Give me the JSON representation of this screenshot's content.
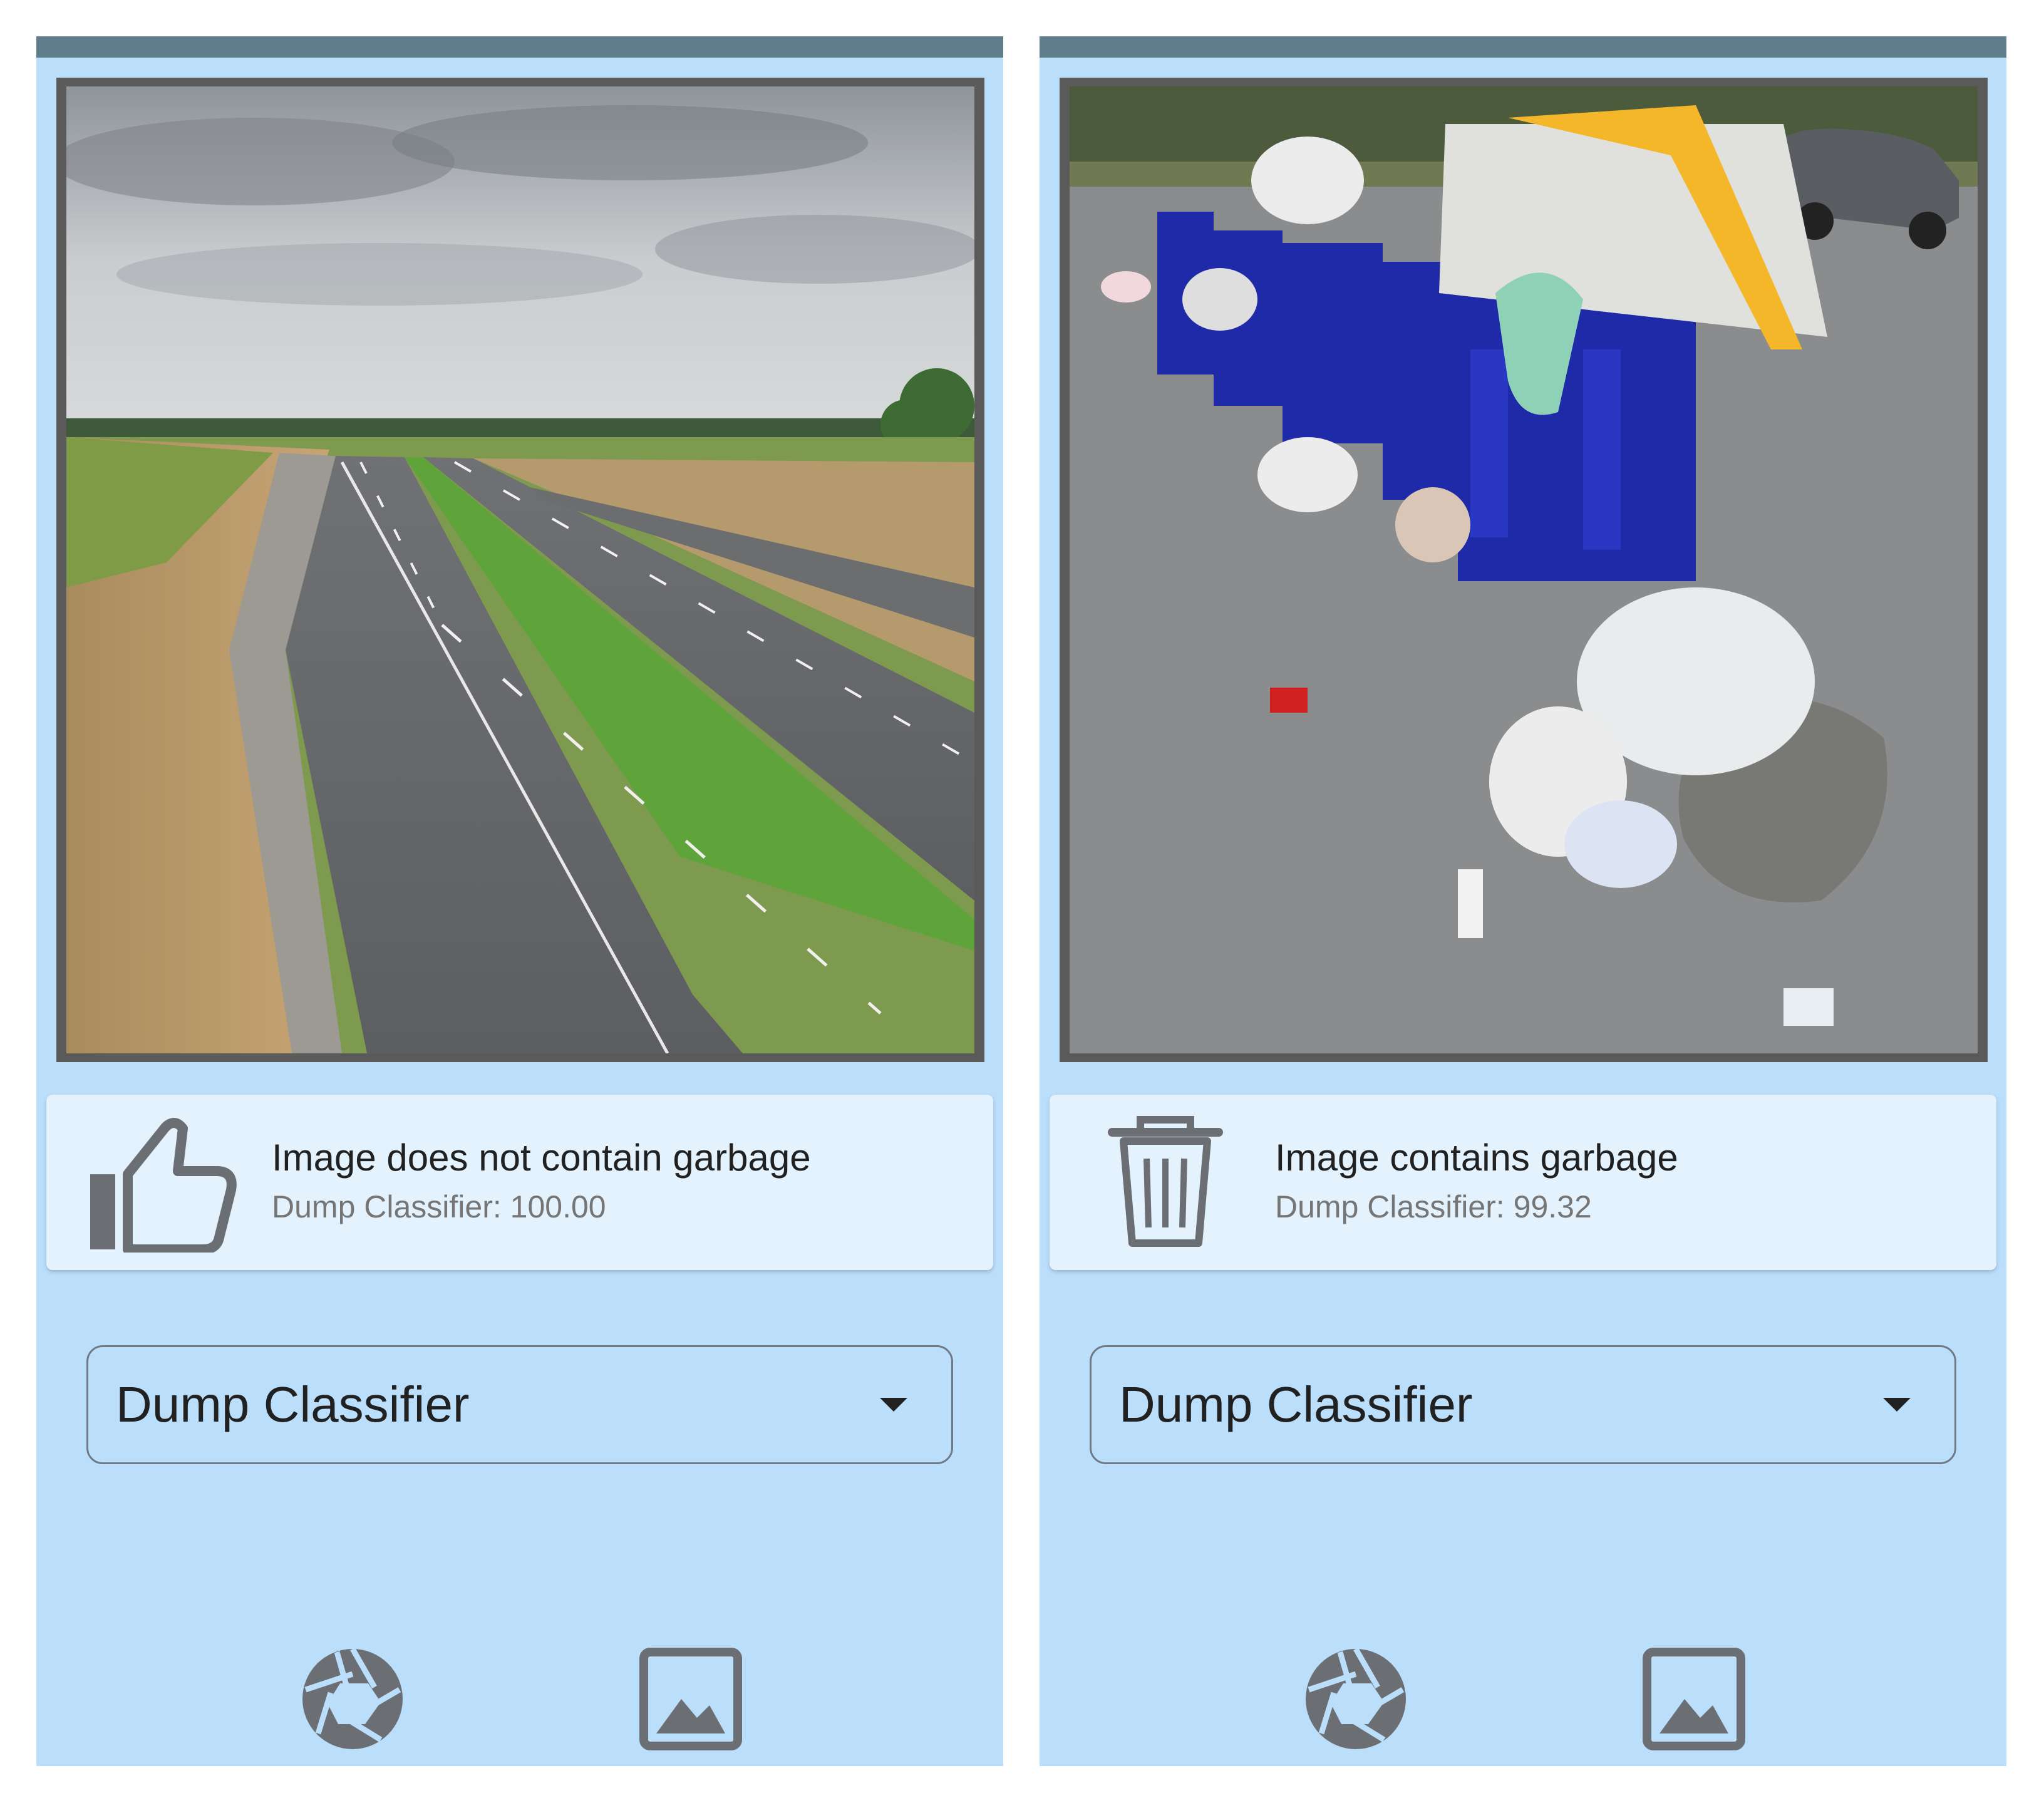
{
  "colors": {
    "background": "#bbdefb",
    "top_bar": "#607d8b",
    "card": "#e3f2fd",
    "icon_gray": "#6b6e72"
  },
  "screens": [
    {
      "photo_description_icon": "highway-photo",
      "result": {
        "icon": "thumbs-up-icon",
        "title": "Image does not contain garbage",
        "subtitle": "Dump Classifier: 100.00"
      },
      "dropdown": {
        "selected": "Dump Classifier",
        "icon": "chevron-down-icon"
      },
      "actions": {
        "camera_icon": "camera-shutter-icon",
        "gallery_icon": "image-gallery-icon"
      }
    },
    {
      "photo_description_icon": "garbage-photo",
      "result": {
        "icon": "trash-icon",
        "title": "Image contains garbage",
        "subtitle": "Dump Classifier: 99.32"
      },
      "dropdown": {
        "selected": "Dump Classifier",
        "icon": "chevron-down-icon"
      },
      "actions": {
        "camera_icon": "camera-shutter-icon",
        "gallery_icon": "image-gallery-icon"
      }
    }
  ]
}
